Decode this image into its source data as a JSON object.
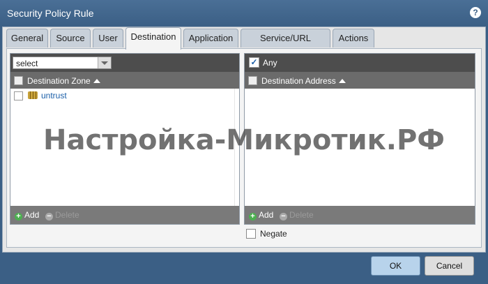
{
  "window": {
    "title": "Security Policy Rule",
    "help_icon": "help-icon"
  },
  "tabs": [
    {
      "label": "General"
    },
    {
      "label": "Source"
    },
    {
      "label": "User"
    },
    {
      "label": "Destination",
      "active": true
    },
    {
      "label": "Application"
    },
    {
      "label": "Service/URL Category"
    },
    {
      "label": "Actions"
    }
  ],
  "left_panel": {
    "select_value": "select",
    "column_header": "Destination Zone",
    "rows": [
      {
        "label": "untrust",
        "icon": "zone-icon"
      }
    ],
    "add_label": "Add",
    "delete_label": "Delete"
  },
  "right_panel": {
    "any_label": "Any",
    "any_checked": true,
    "column_header": "Destination Address",
    "add_label": "Add",
    "delete_label": "Delete"
  },
  "negate_label": "Negate",
  "buttons": {
    "ok": "OK",
    "cancel": "Cancel"
  },
  "watermark": "Настройка-Микротик.РФ",
  "colors": {
    "titlebar": "#3b5f85",
    "link": "#1b5fa8",
    "ok_button": "#b8d3eb"
  }
}
